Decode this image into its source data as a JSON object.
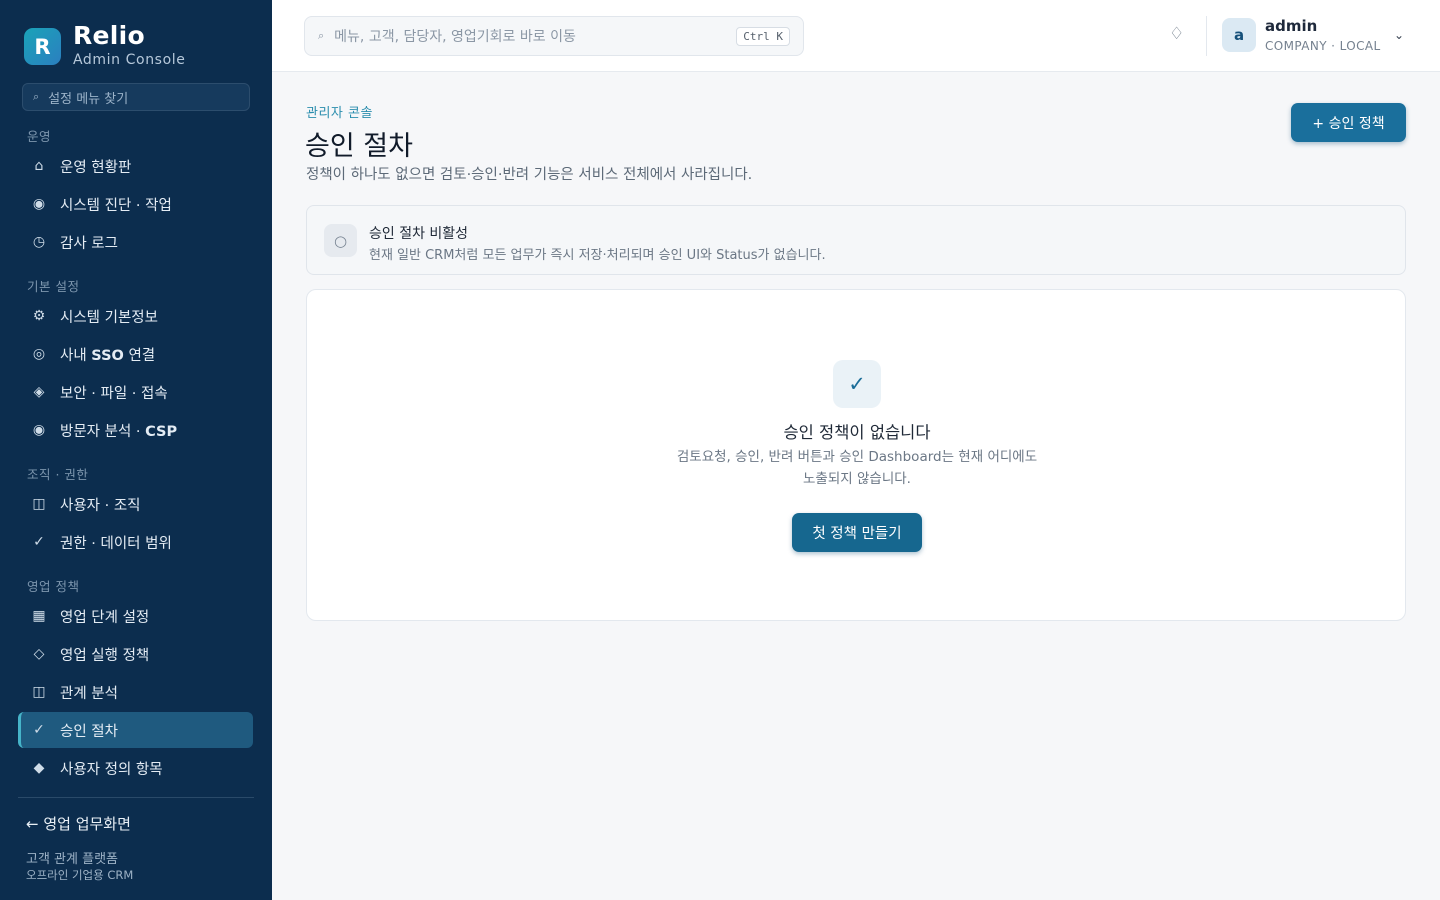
{
  "app": {
    "logo_letter": "R",
    "name": "Relio",
    "subtitle": "Admin Console"
  },
  "sidebar": {
    "search_placeholder": "설정 메뉴 찾기",
    "sections": [
      {
        "label": "운영",
        "items": [
          {
            "icon": "home-icon",
            "label": "운영 현황판"
          },
          {
            "icon": "target-icon",
            "label": "시스템 진단 · 작업"
          },
          {
            "icon": "clock-icon",
            "label": "감사 로그"
          }
        ]
      },
      {
        "label": "기본 설정",
        "items": [
          {
            "icon": "gear-icon",
            "label": "시스템 기본정보"
          },
          {
            "icon": "sso-icon",
            "label_pre": "사내 ",
            "label_bold": "SSO",
            "label_post": " 연결"
          },
          {
            "icon": "shield-icon",
            "label": "보안 · 파일 · 접속"
          },
          {
            "icon": "eye-icon",
            "label_pre": "방문자 분석 · ",
            "label_bold": "CSP"
          }
        ]
      },
      {
        "label": "조직 · 권한",
        "items": [
          {
            "icon": "users-icon",
            "label": "사용자 · 조직"
          },
          {
            "icon": "check-icon",
            "label": "권한 · 데이터 범위"
          }
        ]
      },
      {
        "label": "영업 정책",
        "items": [
          {
            "icon": "grid-icon",
            "label": "영업 단계 설정"
          },
          {
            "icon": "diamond-icon",
            "label": "영업 실행 정책"
          },
          {
            "icon": "network-icon",
            "label": "관계 분석"
          },
          {
            "icon": "check-icon",
            "label": "승인 절차",
            "active": true
          },
          {
            "icon": "diamond-filled-icon",
            "label": "사용자 정의 항목"
          }
        ]
      }
    ],
    "back_link": "← 영업 업무화면",
    "footer_line1": "고객 관계 플랫폼",
    "footer_line2": "오프라인 기업용 CRM"
  },
  "topbar": {
    "search_placeholder": "메뉴, 고객, 담당자, 영업기회로 바로 이동",
    "shortcut": "Ctrl K",
    "user": {
      "avatar_letter": "a",
      "name": "admin",
      "org": "COMPANY · LOCAL"
    }
  },
  "main": {
    "breadcrumb": "관리자 콘솔",
    "title": "승인 절차",
    "description": "정책이 하나도 없으면 검토·승인·반려 기능은 서비스 전체에서 사라집니다.",
    "add_button": "+ 승인 정책",
    "status": {
      "icon": "○",
      "title": "승인 절차 비활성",
      "description": "현재 일반 CRM처럼 모든 업무가 즉시 저장·처리되며 승인 UI와 Status가 없습니다."
    },
    "empty": {
      "icon": "✓",
      "title": "승인 정책이 없습니다",
      "description_line1": "검토요청, 승인, 반려 버튼과 승인 Dashboard는 현재 어디에도",
      "description_line2": "노출되지 않습니다.",
      "button": "첫 정책 만들기"
    }
  }
}
